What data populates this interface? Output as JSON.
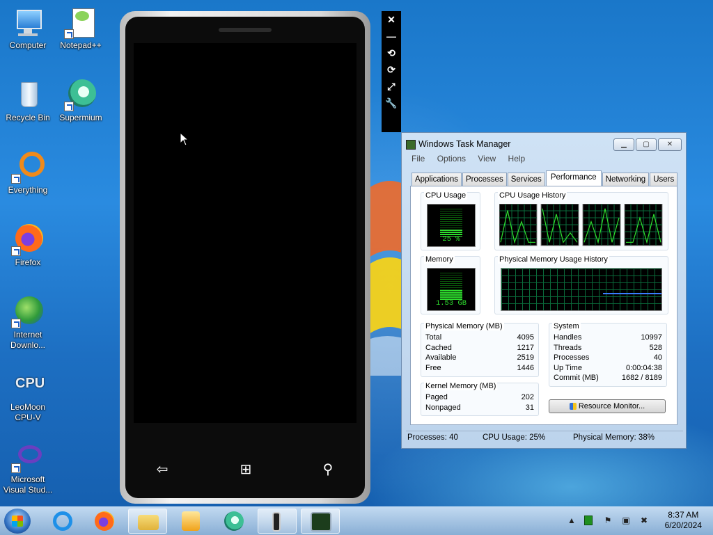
{
  "desktop_icons": [
    {
      "label": "Computer"
    },
    {
      "label": "Notepad++"
    },
    {
      "label": "Recycle Bin"
    },
    {
      "label": "Supermium"
    },
    {
      "label": "Everything"
    },
    {
      "label": "Firefox"
    },
    {
      "label": "Internet Downlo..."
    },
    {
      "label": "LeoMoon CPU-V"
    },
    {
      "label": "Microsoft Visual Stud..."
    }
  ],
  "emulator": {
    "toolbar": [
      {
        "glyph": "✕",
        "icon": "close-icon"
      },
      {
        "glyph": "—",
        "icon": "minimize-icon"
      },
      {
        "glyph": "⟲",
        "icon": "rotate-left-icon"
      },
      {
        "glyph": "⟳",
        "icon": "rotate-right-icon"
      },
      {
        "glyph": "⤢",
        "icon": "fit-to-screen-icon"
      },
      {
        "glyph": "🔧",
        "icon": "tools-icon"
      }
    ],
    "softkeys": {
      "back": "⇦",
      "start": "⊞",
      "search": "⚲"
    }
  },
  "task_manager": {
    "title": "Windows Task Manager",
    "window_buttons": {
      "minimize": "▁",
      "maximize": "▢",
      "close": "✕"
    },
    "menu": [
      "File",
      "Options",
      "View",
      "Help"
    ],
    "tabs": [
      "Applications",
      "Processes",
      "Services",
      "Performance",
      "Networking",
      "Users"
    ],
    "active_tab": "Performance",
    "cpu_usage_caption": "CPU Usage",
    "cpu_usage_value": "25 %",
    "cpu_usage_fraction": 0.25,
    "cpu_history_caption": "CPU Usage History",
    "memory_caption": "Memory",
    "memory_value": "1.53 GB",
    "memory_fraction": 0.38,
    "mem_history_caption": "Physical Memory Usage History",
    "physical_memory": {
      "caption": "Physical Memory (MB)",
      "rows": [
        {
          "k": "Total",
          "v": "4095"
        },
        {
          "k": "Cached",
          "v": "1217"
        },
        {
          "k": "Available",
          "v": "2519"
        },
        {
          "k": "Free",
          "v": "1446"
        }
      ]
    },
    "kernel_memory": {
      "caption": "Kernel Memory (MB)",
      "rows": [
        {
          "k": "Paged",
          "v": "202"
        },
        {
          "k": "Nonpaged",
          "v": "31"
        }
      ]
    },
    "system": {
      "caption": "System",
      "rows": [
        {
          "k": "Handles",
          "v": "10997"
        },
        {
          "k": "Threads",
          "v": "528"
        },
        {
          "k": "Processes",
          "v": "40"
        },
        {
          "k": "Up Time",
          "v": "0:00:04:38"
        },
        {
          "k": "Commit (MB)",
          "v": "1682 / 8189"
        }
      ]
    },
    "resource_monitor_button": "Resource Monitor...",
    "status": {
      "processes": "Processes: 40",
      "cpu": "CPU Usage: 25%",
      "memory": "Physical Memory: 38%"
    }
  },
  "taskbar": {
    "clock_time": "8:37 AM",
    "clock_date": "6/20/2024",
    "tray_icons": [
      "show-hidden-icons-icon",
      "network-monitor-icon",
      "action-center-flag-icon",
      "network-icon",
      "volume-muted-icon"
    ]
  },
  "colors": {
    "meter_green": "#2ee02e",
    "grid_green": "#0a6a3a",
    "memory_line": "#3a7cff"
  }
}
